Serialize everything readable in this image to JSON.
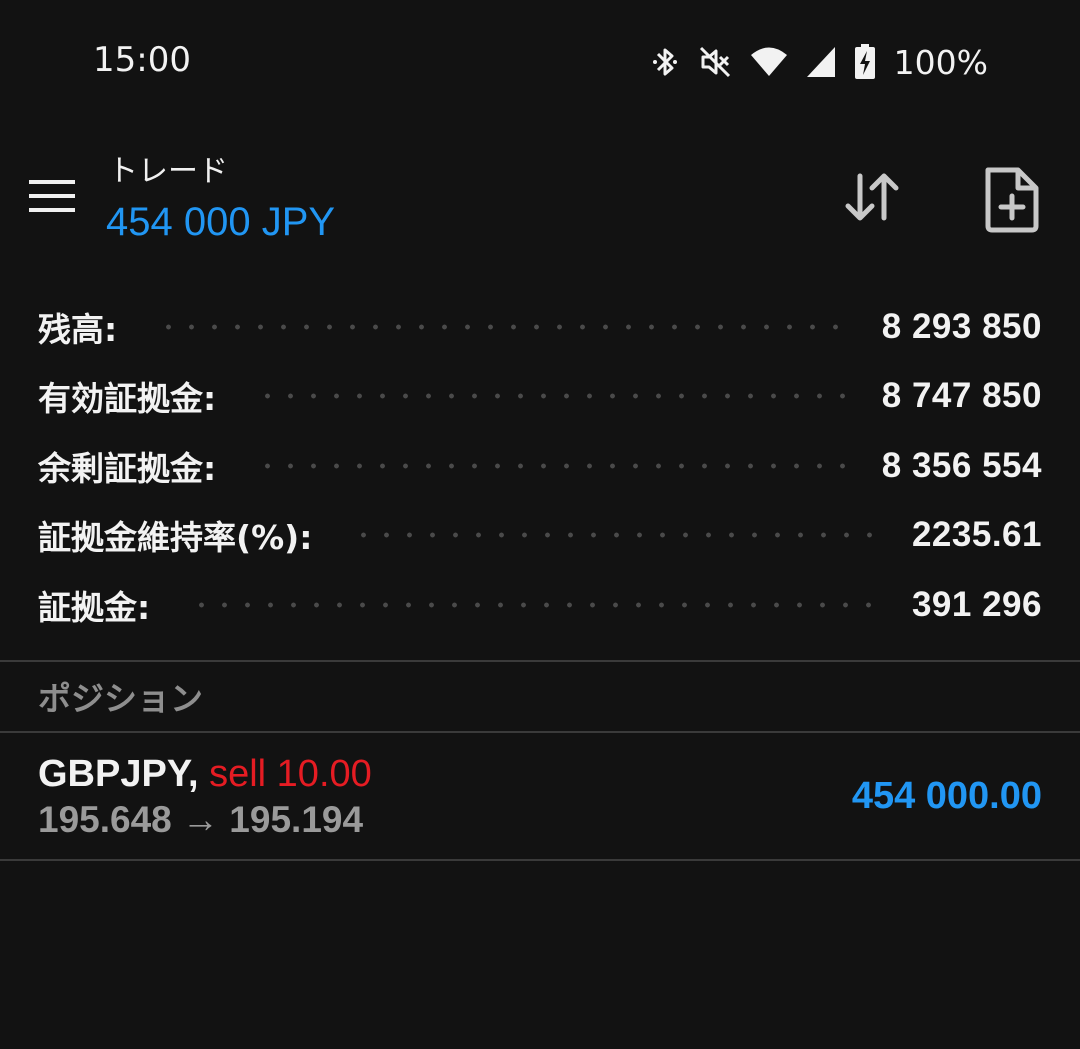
{
  "status_bar": {
    "time": "15:00",
    "battery": "100%",
    "icons": [
      "bluetooth-icon",
      "mute-icon",
      "wifi-icon",
      "cell-signal-icon",
      "battery-charging-icon"
    ]
  },
  "toolbar": {
    "title": "トレード",
    "subtitle": "454 000 JPY",
    "icons": [
      "menu-icon",
      "sort-icon",
      "new-order-icon"
    ]
  },
  "summary": [
    {
      "label": "残高:",
      "value": "8 293 850"
    },
    {
      "label": "有効証拠金:",
      "value": "8 747 850"
    },
    {
      "label": "余剰証拠金:",
      "value": "8 356 554"
    },
    {
      "label": "証拠金維持率(%):",
      "value": "2235.61"
    },
    {
      "label": "証拠金:",
      "value": "391 296"
    }
  ],
  "positions_header": "ポジション",
  "positions": [
    {
      "symbol": "GBPJPY,",
      "type": "sell 10.00",
      "prices": "195.648 → 195.194",
      "profit": "454 000.00"
    }
  ],
  "colors": {
    "background": "#121212",
    "accent_blue": "#2196f3",
    "sell_red": "#e51c23",
    "muted_gray": "#9a9a9a"
  }
}
